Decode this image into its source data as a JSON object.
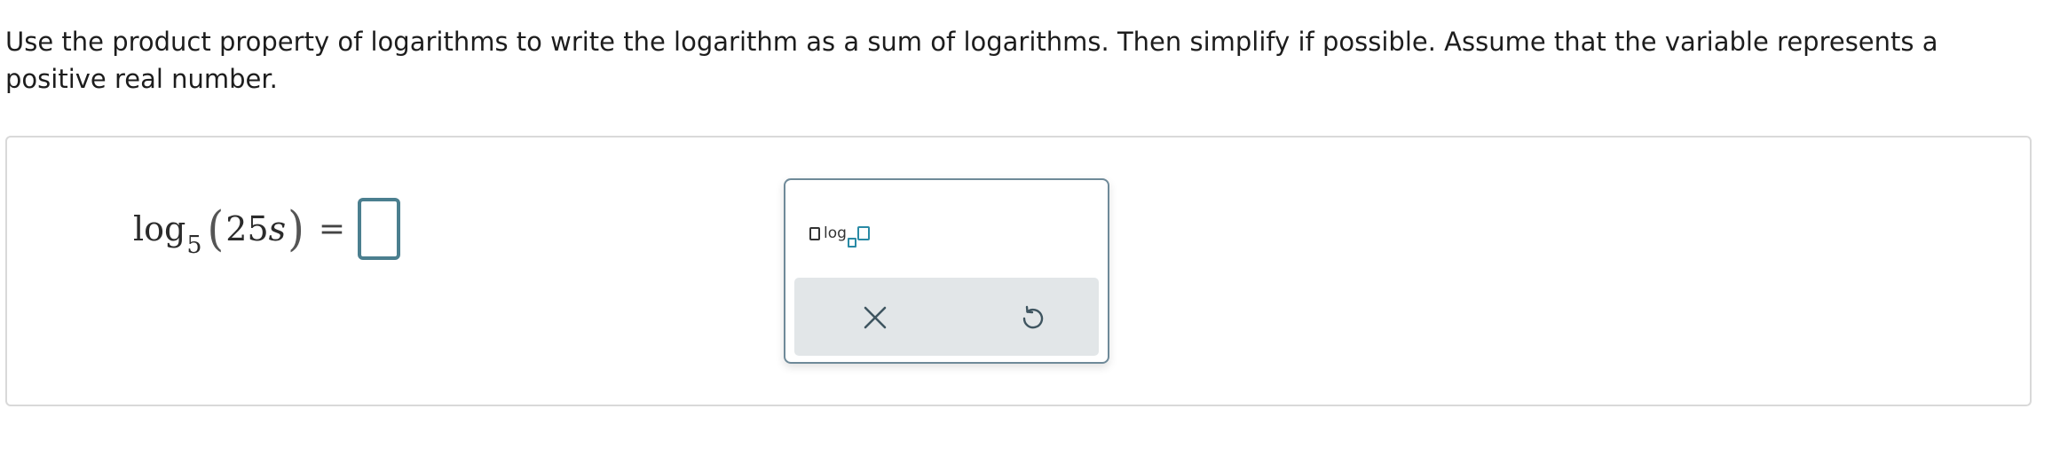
{
  "instructions": {
    "text": "Use the product property of logarithms to write the logarithm as a sum of logarithms. Then simplify if possible. Assume that the variable represents a positive real number."
  },
  "equation": {
    "log_word": "log",
    "base": "5",
    "left_paren": "(",
    "argument_number": "25",
    "argument_variable": "s",
    "right_paren": ")",
    "equals": "=",
    "answer_value": ""
  },
  "palette": {
    "log_template_label": "log",
    "icons": {
      "clear": "close-icon",
      "undo": "undo-icon"
    }
  },
  "colors": {
    "answer_box_border": "#4b7f8f",
    "template_accent": "#2a8aa5",
    "palette_border": "#6f8a99",
    "action_bar_bg": "#e2e6e8"
  }
}
